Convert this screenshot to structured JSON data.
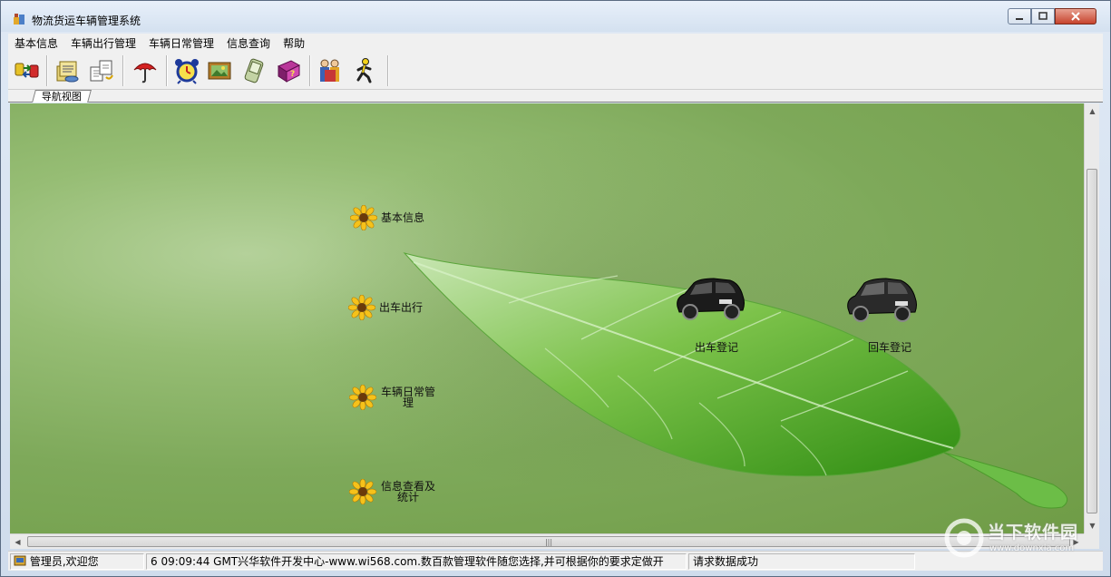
{
  "window": {
    "title": "物流货运车辆管理系统"
  },
  "menu": [
    "基本信息",
    "车辆出行管理",
    "车辆日常管理",
    "信息查询",
    "帮助"
  ],
  "toolbar": {
    "buttons": [
      {
        "icon": "transfer-icon"
      },
      {
        "icon": "document-stack-icon"
      },
      {
        "icon": "files-swap-icon"
      },
      {
        "icon": "umbrella-icon"
      },
      {
        "icon": "alarm-clock-icon"
      },
      {
        "icon": "picture-frame-icon"
      },
      {
        "icon": "handheld-pda-icon"
      },
      {
        "icon": "help-book-icon"
      },
      {
        "icon": "users-group-icon"
      },
      {
        "icon": "running-man-icon"
      }
    ]
  },
  "tab": {
    "label": "导航视图"
  },
  "navigation": {
    "items": [
      {
        "label": "基本信息",
        "icon": "sunflower-icon"
      },
      {
        "label": "出车出行",
        "icon": "sunflower-icon"
      },
      {
        "label": "车辆日常管理",
        "icon": "sunflower-icon"
      },
      {
        "label": "信息查看及统计",
        "icon": "sunflower-icon"
      }
    ],
    "cars": [
      {
        "label": "出车登记",
        "icon": "car-icon"
      },
      {
        "label": "回车登记",
        "icon": "car-icon"
      }
    ]
  },
  "status": {
    "user": "管理员,欢迎您",
    "message": "6 09:09:44 GMT兴华软件开发中心-www.wi568.com.数百款管理软件随您选择,并可根据你的要求定做开",
    "result": "请求数据成功"
  },
  "watermark": {
    "text": "当下软件园",
    "url": "www.downxia.com"
  },
  "colors": {
    "background_green": "#7ea95a",
    "leaf_green": "#4fa82a",
    "chrome": "#f0f0f0"
  }
}
